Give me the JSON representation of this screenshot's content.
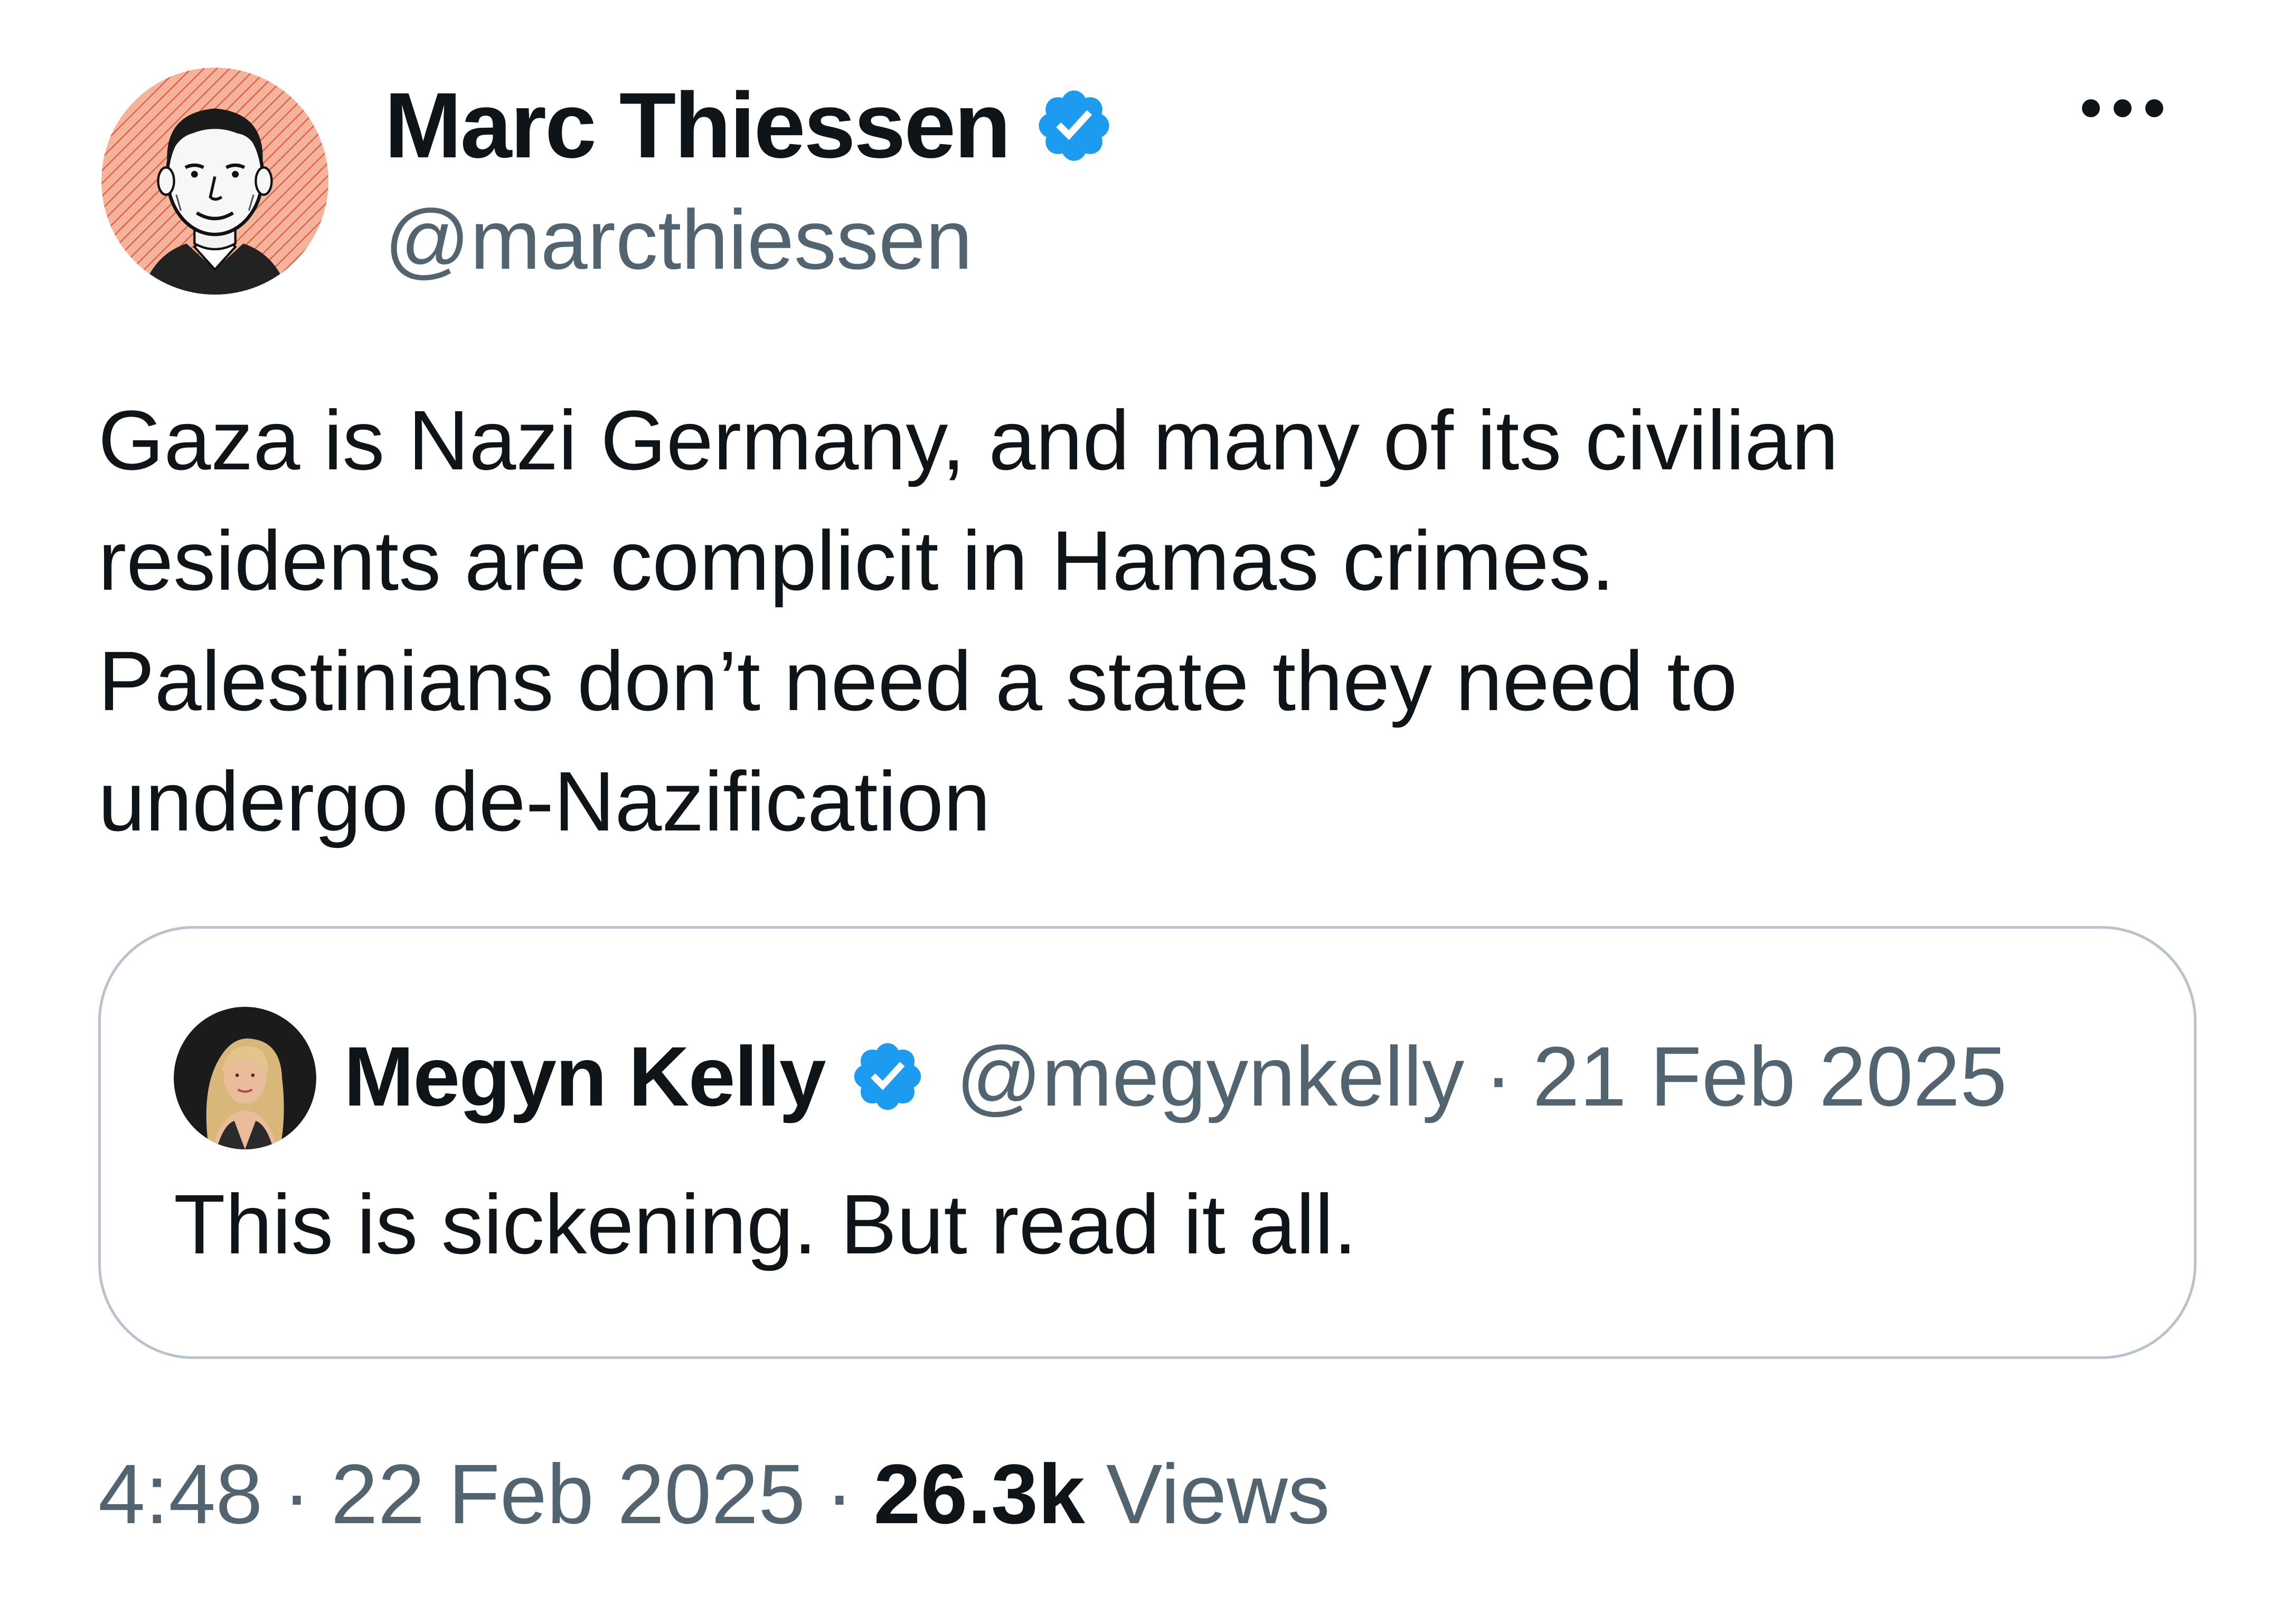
{
  "tweet": {
    "author": {
      "name": "Marc Thiessen",
      "handle": "@marcthiessen",
      "avatar_icon": "person-illustration-avatar",
      "verified_icon": "verified-badge-icon"
    },
    "more_icon": "more-options-icon",
    "text": "Gaza is Nazi Germany, and many of its civilian\nresidents are complicit in Hamas crimes.\nPalestinians don’t need a state they need to\nundergo de-Nazification",
    "quoted": {
      "name": "Megyn Kelly",
      "handle": "@megynkelly",
      "separator": "·",
      "date": "21 Feb 2025",
      "text": "This is sickening. But read it all.",
      "avatar_icon": "person-photo-avatar",
      "verified_icon": "verified-badge-icon"
    },
    "meta": {
      "time": "4:48",
      "separator": "·",
      "date": "22 Feb 2025",
      "views_count": "26.3k",
      "views_label": "Views"
    },
    "colors": {
      "verified": "#1d9bf0",
      "primary_text": "#0f1419",
      "secondary_text": "#536471",
      "border": "#b7c2cc",
      "avatar_background": "#f4a78d"
    }
  }
}
